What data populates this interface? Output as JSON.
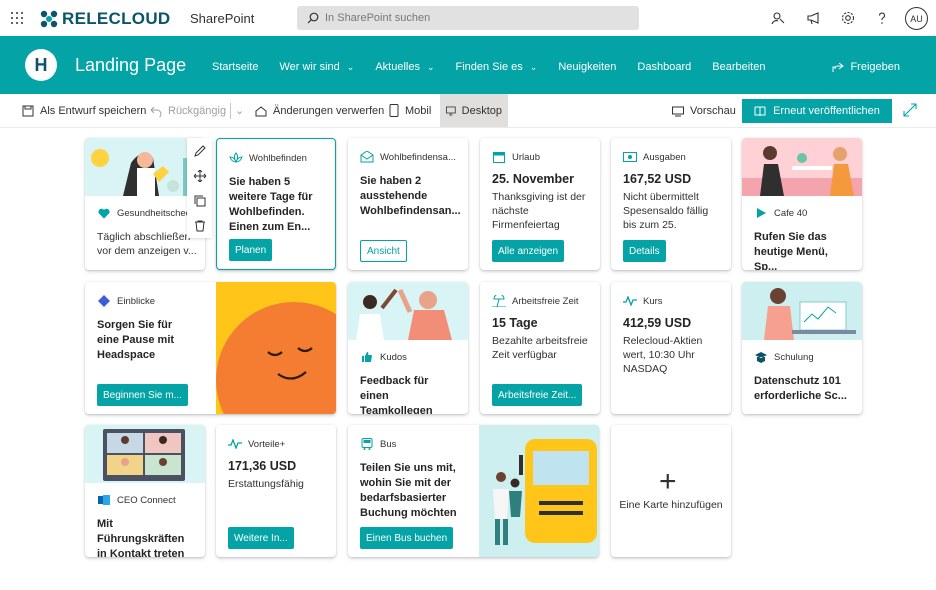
{
  "topbar": {
    "brand": "RELECLOUD",
    "app": "SharePoint",
    "search_placeholder": "In SharePoint suchen",
    "avatar": "AU"
  },
  "header": {
    "logo": "H",
    "title": "Landing Page",
    "share": "Freigeben",
    "nav": [
      {
        "label": "Startseite",
        "dropdown": false
      },
      {
        "label": "Wer wir sind",
        "dropdown": true
      },
      {
        "label": "Aktuelles",
        "dropdown": true
      },
      {
        "label": "Finden Sie es",
        "dropdown": true
      },
      {
        "label": "Neuigkeiten",
        "dropdown": false
      },
      {
        "label": "Dashboard",
        "dropdown": false
      },
      {
        "label": "Bearbeiten",
        "dropdown": false
      }
    ]
  },
  "commandbar": {
    "save_draft": "Als Entwurf speichern",
    "undo": "Rückgängig",
    "discard": "Änderungen verwerfen",
    "mobile": "Mobil",
    "desktop": "Desktop",
    "preview": "Vorschau",
    "republish": "Erneut veröffentlichen"
  },
  "cards": {
    "wellbeing_check": {
      "header": "Gesundheitscheck",
      "text": "Täglich abschließen vor dem anzeigen v..."
    },
    "wohlbefinden": {
      "header": "Wohlbefinden",
      "title": "Sie haben 5 weitere Tage für Wohlbefinden. Einen zum En...",
      "button": "Planen"
    },
    "wohlbefindensa": {
      "header": "Wohlbefindensa...",
      "title": "Sie haben 2 ausstehende Wohlbefindensan...",
      "button": "Ansicht"
    },
    "urlaub": {
      "header": "Urlaub",
      "title": "25. November",
      "sub": "Thanksgiving ist der nächste Firmenfeiertag",
      "button": "Alle anzeigen"
    },
    "ausgaben": {
      "header": "Ausgaben",
      "title": "167,52 USD",
      "sub": "Nicht übermittelt Spesensaldo fällig bis zum 25.",
      "button": "Details"
    },
    "cafe": {
      "header": "Cafe 40",
      "title": "Rufen Sie das heutige Menü, Sp..."
    },
    "einblicke": {
      "header": "Einblicke",
      "title": "Sorgen Sie für eine Pause mit Headspace",
      "button": "Beginnen Sie m..."
    },
    "kudos": {
      "header": "Kudos",
      "title": "Feedback für einen Teamkollegen ber..."
    },
    "arbeitsfrei": {
      "header": "Arbeitsfreie Zeit",
      "title": "15 Tage",
      "sub": "Bezahlte arbeitsfreie Zeit verfügbar",
      "button": "Arbeitsfreie Zeit..."
    },
    "kurs": {
      "header": "Kurs",
      "title": "412,59 USD",
      "sub": "Relecloud-Aktien wert, 10:30 Uhr NASDAQ"
    },
    "schulung": {
      "header": "Schulung",
      "title": "Datenschutz 101 erforderliche Sc..."
    },
    "ceo": {
      "header": "CEO Connect",
      "title": "Mit Führungskräften in Kontakt treten"
    },
    "vorteile": {
      "header": "Vorteile+",
      "title": "171,36 USD",
      "sub": "Erstattungsfähig",
      "button": "Weitere In..."
    },
    "bus": {
      "header": "Bus",
      "title": "Teilen Sie uns mit, wohin Sie mit der bedarfsbasierter Buchung möchten",
      "button": "Einen Bus buchen"
    },
    "add": {
      "label": "Eine Karte hinzufügen"
    }
  },
  "colors": {
    "accent": "#03a3a6",
    "brand": "#0b556a"
  }
}
